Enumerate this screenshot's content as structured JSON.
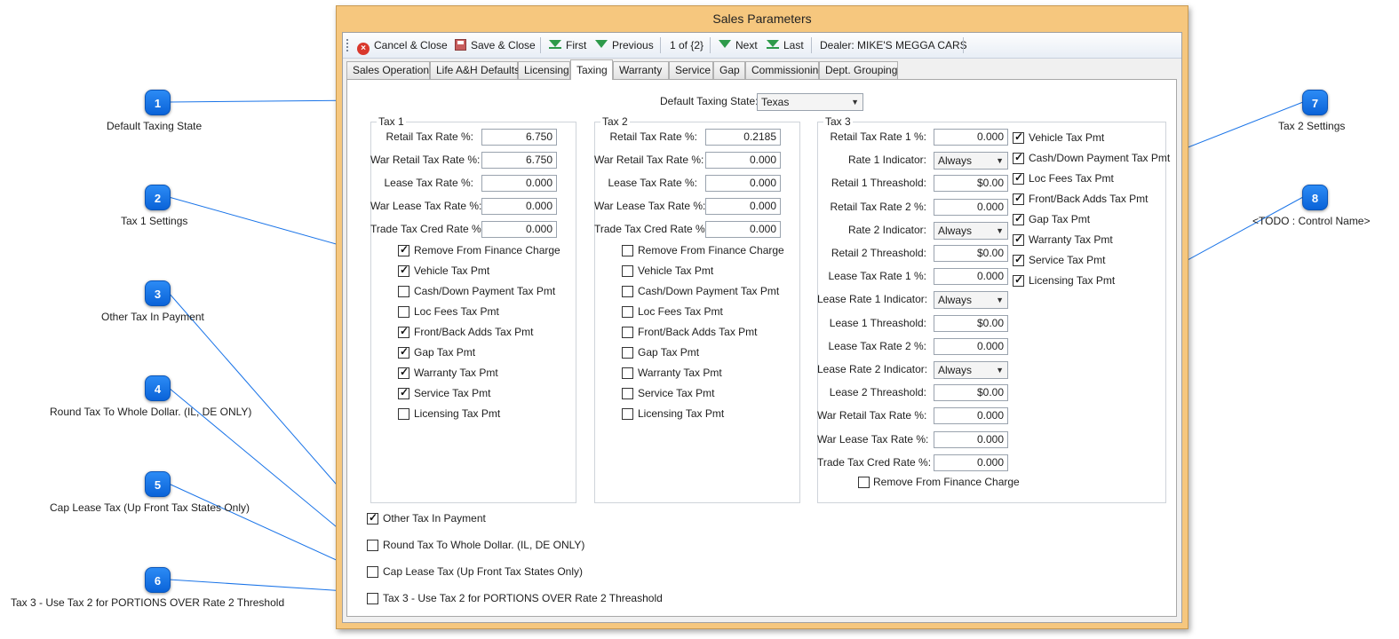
{
  "window": {
    "title": "Sales Parameters"
  },
  "toolbar": {
    "cancel_label": "Cancel & Close",
    "save_label": "Save & Close",
    "first_label": "First",
    "previous_label": "Previous",
    "record_position": "1 of {2}",
    "next_label": "Next",
    "last_label": "Last",
    "dealer": "Dealer: MIKE'S MEGGA CARS"
  },
  "tabs": [
    "Sales Operation",
    "Life A&H Defaults",
    "Licensing",
    "Taxing",
    "Warranty",
    "Service",
    "Gap",
    "Commissioning",
    "Dept. Grouping"
  ],
  "default_state": {
    "label": "Default Taxing State:",
    "value": "Texas"
  },
  "tax1": {
    "title": "Tax 1",
    "fields": [
      {
        "label": "Retail Tax Rate %:",
        "value": "6.750"
      },
      {
        "label": "War Retail Tax  Rate %:",
        "value": "6.750"
      },
      {
        "label": "Lease Tax Rate %:",
        "value": "0.000"
      },
      {
        "label": "War Lease Tax Rate %:",
        "value": "0.000"
      },
      {
        "label": "Trade Tax Cred Rate %:",
        "value": "0.000"
      }
    ],
    "checks": [
      {
        "label": "Remove From Finance Charge",
        "checked": true
      },
      {
        "label": "Vehicle Tax Pmt",
        "checked": true
      },
      {
        "label": "Cash/Down Payment Tax Pmt",
        "checked": false
      },
      {
        "label": "Loc Fees Tax Pmt",
        "checked": false
      },
      {
        "label": "Front/Back Adds Tax Pmt",
        "checked": true
      },
      {
        "label": "Gap Tax Pmt",
        "checked": true
      },
      {
        "label": "Warranty Tax Pmt",
        "checked": true
      },
      {
        "label": "Service Tax Pmt",
        "checked": true
      },
      {
        "label": "Licensing Tax Pmt",
        "checked": false
      }
    ]
  },
  "tax2": {
    "title": "Tax 2",
    "fields": [
      {
        "label": "Retail Tax Rate %:",
        "value": "0.2185"
      },
      {
        "label": "War Retail Tax  Rate %:",
        "value": "0.000"
      },
      {
        "label": "Lease Tax Rate %:",
        "value": "0.000"
      },
      {
        "label": "War Lease Tax Rate %:",
        "value": "0.000"
      },
      {
        "label": "Trade Tax Cred Rate %:",
        "value": "0.000"
      }
    ],
    "checks": [
      {
        "label": "Remove From Finance Charge",
        "checked": false
      },
      {
        "label": "Vehicle Tax Pmt",
        "checked": false
      },
      {
        "label": "Cash/Down Payment Tax Pmt",
        "checked": false
      },
      {
        "label": "Loc Fees Tax Pmt",
        "checked": false
      },
      {
        "label": "Front/Back Adds Tax Pmt",
        "checked": false
      },
      {
        "label": "Gap Tax Pmt",
        "checked": false
      },
      {
        "label": "Warranty Tax Pmt",
        "checked": false
      },
      {
        "label": "Service Tax Pmt",
        "checked": false
      },
      {
        "label": "Licensing Tax Pmt",
        "checked": false
      }
    ]
  },
  "tax3": {
    "title": "Tax 3",
    "fields": [
      {
        "label": "Retail Tax Rate 1 %:",
        "kind": "text",
        "value": "0.000"
      },
      {
        "label": "Rate 1 Indicator:",
        "kind": "select",
        "value": "Always"
      },
      {
        "label": "Retail 1 Threashold:",
        "kind": "text",
        "value": "$0.00"
      },
      {
        "label": "Retail Tax Rate 2 %:",
        "kind": "text",
        "value": "0.000"
      },
      {
        "label": "Rate 2 Indicator:",
        "kind": "select",
        "value": "Always"
      },
      {
        "label": "Retail 2 Threashold:",
        "kind": "text",
        "value": "$0.00"
      },
      {
        "label": "Lease Tax Rate 1 %:",
        "kind": "text",
        "value": "0.000"
      },
      {
        "label": "Lease Rate 1 Indicator:",
        "kind": "select",
        "value": "Always"
      },
      {
        "label": "Lease 1 Threashold:",
        "kind": "text",
        "value": "$0.00"
      },
      {
        "label": "Lease Tax Rate 2 %:",
        "kind": "text",
        "value": "0.000"
      },
      {
        "label": "Lease Rate 2 Indicator:",
        "kind": "select",
        "value": "Always"
      },
      {
        "label": "Lease 2 Threashold:",
        "kind": "text",
        "value": "$0.00"
      },
      {
        "label": "War Retail Tax  Rate %:",
        "kind": "text",
        "value": "0.000"
      },
      {
        "label": "War Lease Tax Rate %:",
        "kind": "text",
        "value": "0.000"
      },
      {
        "label": "Trade Tax Cred Rate %:",
        "kind": "text",
        "value": "0.000"
      }
    ],
    "remove_finance": {
      "label": "Remove From Finance Charge",
      "checked": false
    },
    "checks": [
      {
        "label": "Vehicle Tax Pmt",
        "checked": true
      },
      {
        "label": "Cash/Down Payment Tax Pmt",
        "checked": true
      },
      {
        "label": "Loc Fees Tax Pmt",
        "checked": true
      },
      {
        "label": "Front/Back Adds Tax Pmt",
        "checked": true
      },
      {
        "label": "Gap Tax Pmt",
        "checked": true
      },
      {
        "label": "Warranty Tax Pmt",
        "checked": true
      },
      {
        "label": "Service Tax Pmt",
        "checked": true
      },
      {
        "label": "Licensing Tax Pmt",
        "checked": true
      }
    ]
  },
  "bottom_checks": [
    {
      "label": "Other Tax In Payment",
      "checked": true
    },
    {
      "label": "Round Tax To Whole Dollar. (IL, DE ONLY)",
      "checked": false
    },
    {
      "label": "Cap Lease Tax (Up Front Tax States Only)",
      "checked": false
    },
    {
      "label": "Tax 3 - Use Tax 2 for PORTIONS OVER Rate 2 Threashold",
      "checked": false
    }
  ],
  "callouts": [
    {
      "num": "1",
      "label": "Default Taxing State"
    },
    {
      "num": "2",
      "label": "Tax 1 Settings"
    },
    {
      "num": "3",
      "label": "Other Tax In Payment"
    },
    {
      "num": "4",
      "label": "Round Tax To Whole Dollar. (IL, DE ONLY)"
    },
    {
      "num": "5",
      "label": "Cap Lease Tax (Up Front Tax States Only)"
    },
    {
      "num": "6",
      "label": "Tax 3 - Use Tax 2 for PORTIONS OVER Rate 2 Threshold"
    },
    {
      "num": "7",
      "label": "Tax 2 Settings"
    },
    {
      "num": "8",
      "label": "<TODO : Control Name>"
    }
  ],
  "colors": {
    "window_frame": "#f6c77e",
    "callout_badge": "#1a74e8",
    "callout_line": "#1a74e8"
  }
}
